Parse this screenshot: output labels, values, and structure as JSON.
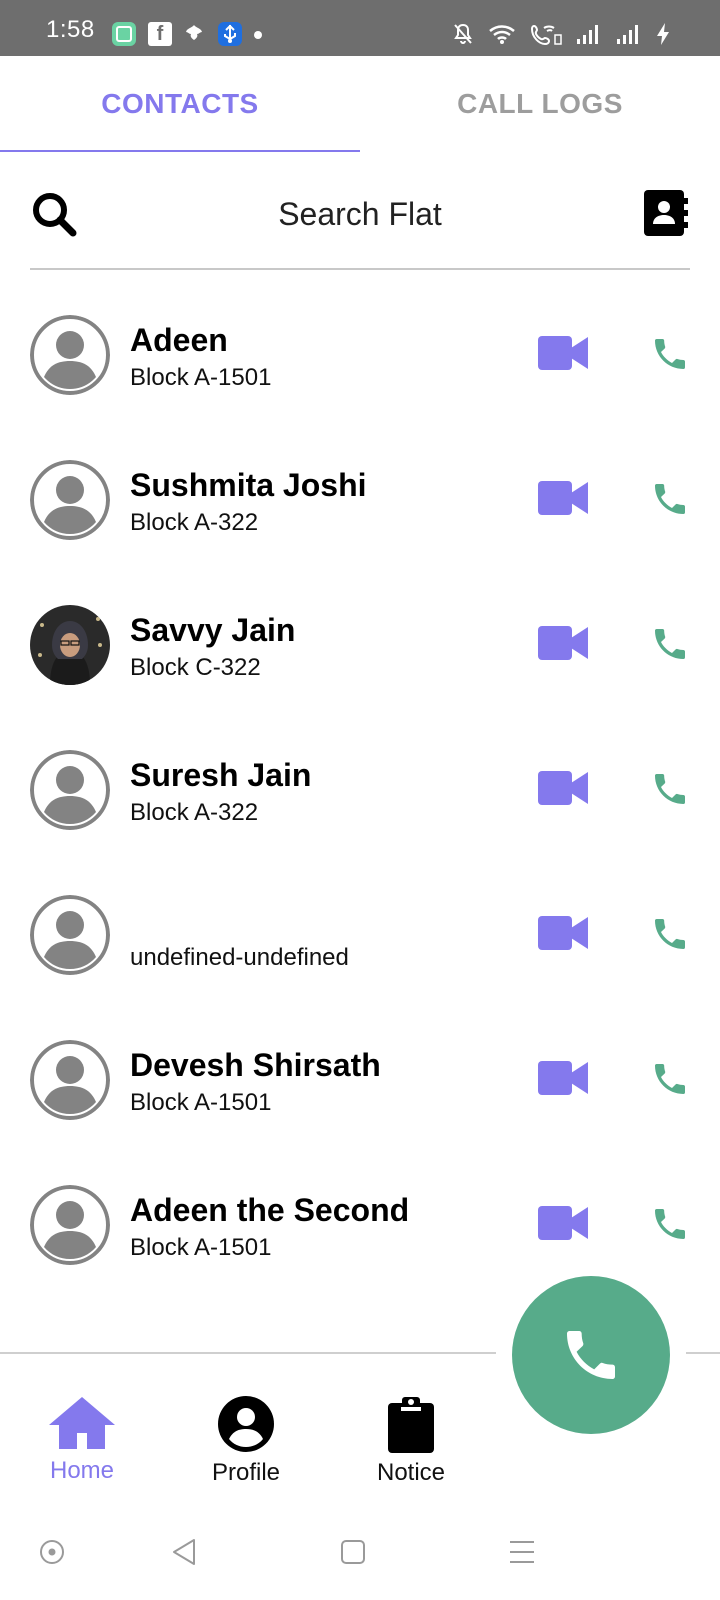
{
  "status_bar": {
    "time": "1:58",
    "icons": [
      "app-notification-icon",
      "facebook-icon",
      "leaf-icon",
      "usb-icon",
      "dot-icon",
      "mute-icon",
      "wifi-icon",
      "wifi-calling-icon",
      "signal-icon",
      "signal-icon",
      "charging-icon"
    ]
  },
  "tabs": [
    {
      "label": "CONTACTS",
      "active": true
    },
    {
      "label": "CALL LOGS",
      "active": false
    }
  ],
  "search": {
    "placeholder": "Search Flat",
    "value": ""
  },
  "contacts": [
    {
      "name": "Adeen",
      "flat": "Block A-1501",
      "avatar": "default"
    },
    {
      "name": "Sushmita Joshi",
      "flat": "Block A-322",
      "avatar": "default"
    },
    {
      "name": "Savvy Jain",
      "flat": "Block C-322",
      "avatar": "photo"
    },
    {
      "name": "Suresh Jain",
      "flat": "Block A-322",
      "avatar": "default"
    },
    {
      "name": "",
      "flat": "undefined-undefined",
      "avatar": "default"
    },
    {
      "name": "Devesh Shirsath",
      "flat": "Block A-1501",
      "avatar": "default"
    },
    {
      "name": "Adeen the Second",
      "flat": "Block A-1501",
      "avatar": "default"
    }
  ],
  "bottom_nav": {
    "home": "Home",
    "profile": "Profile",
    "notice": "Notice"
  },
  "colors": {
    "accent": "#8479ed",
    "call_green": "#57ab8a",
    "avatar_gray": "#838383",
    "inactive_tab": "#9d9d9d"
  }
}
